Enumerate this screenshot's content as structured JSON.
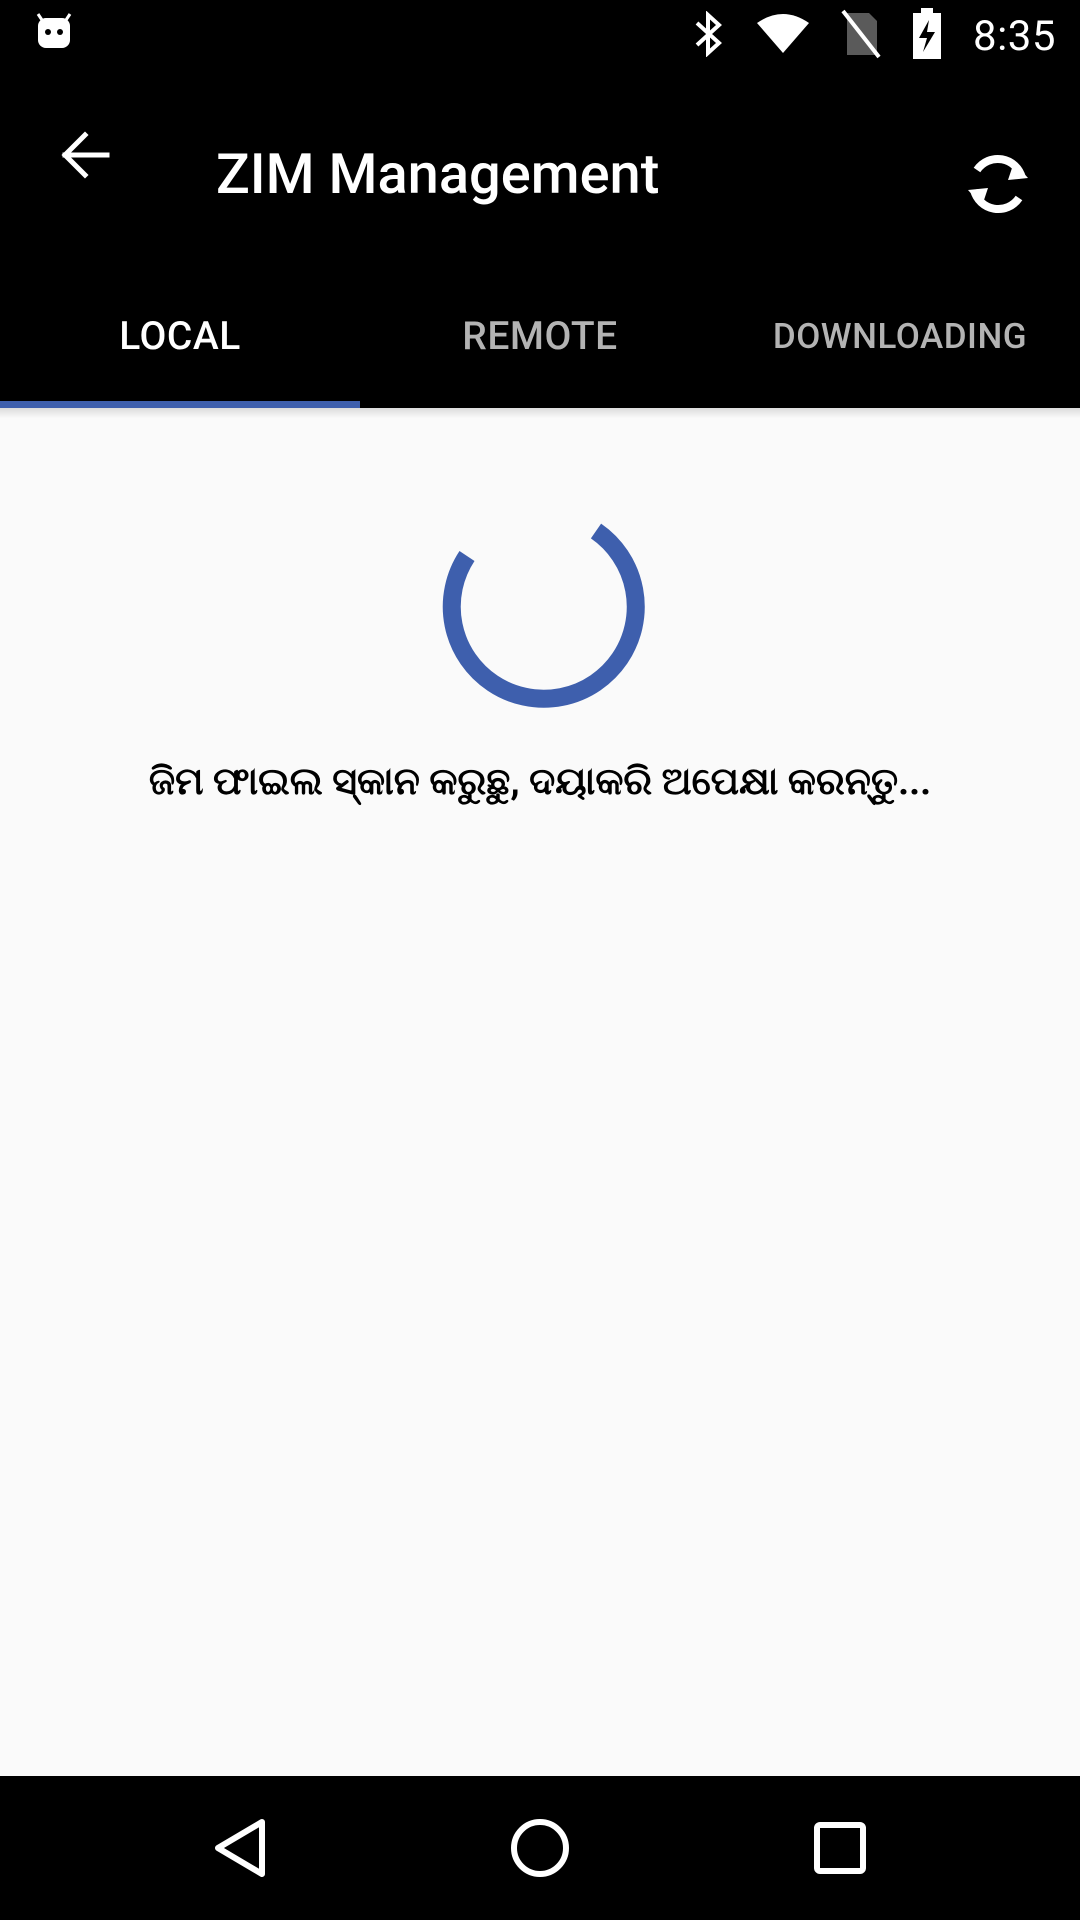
{
  "status_bar": {
    "time": "8:35",
    "icons": [
      "android-icon",
      "bluetooth-icon",
      "wifi-icon",
      "no-sim-icon",
      "battery-charging-icon"
    ]
  },
  "toolbar": {
    "title": "ZIM Management",
    "back_icon": "arrow-back-icon",
    "refresh_icon": "refresh-icon"
  },
  "tabs": [
    {
      "label": "LOCAL",
      "active": true
    },
    {
      "label": "REMOTE",
      "active": false
    },
    {
      "label": "DOWNLOADING",
      "active": false
    }
  ],
  "content": {
    "loading_message": "ଜିମ ଫାଇଲ ସ୍କାନ କରୁଛୁ, ଦୟାକରି ଅପେକ୍ଷା କରନ୍ତୁ..."
  },
  "nav_bar": {
    "icons": [
      "nav-back-icon",
      "nav-home-icon",
      "nav-recents-icon"
    ]
  },
  "colors": {
    "accent": "#3E5FAD",
    "toolbar_bg": "#000000",
    "content_bg": "#FAFAFA"
  }
}
